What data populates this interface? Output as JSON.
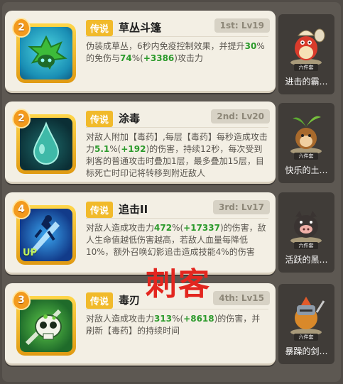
{
  "skills": [
    {
      "level": "2",
      "tag": "传说",
      "name": "草丛斗篷",
      "rank": "1st: Lv19",
      "desc_parts": [
        "伪装成草丛，6秒内免疫控制效果，并提升",
        "30",
        "%的免伤与",
        "74",
        "%(",
        "+3386",
        ")攻击力"
      ],
      "pet_name": "进击的霸…",
      "pet_badge": "六件套",
      "icon": "grass-cloak-icon"
    },
    {
      "level": "2",
      "tag": "传说",
      "name": "涂毒",
      "rank": "2nd: Lv20",
      "desc_parts": [
        "对敌人附加【毒药】,每层【毒药】每秒造成攻击力",
        "5.1",
        "%(",
        "+192",
        ")的伤害，持续12秒，每次受到刺客的普通攻击时叠加1层，最多叠加15层，目标死亡时印记将转移到附近敌人"
      ],
      "pet_name": "快乐的土…",
      "pet_badge": "六件套",
      "icon": "poison-drop-icon"
    },
    {
      "level": "4",
      "tag": "传说",
      "name": "追击II",
      "rank": "3rd: Lv17",
      "desc_parts": [
        "对敌人造成攻击力",
        "472",
        "%(",
        "+17337",
        ")的伤害，敌人生命值越低伤害越高，若敌人血量每降低10%，额外召唤幻影追击造成技能4%的伤害"
      ],
      "pet_name": "活跃的黑…",
      "pet_badge": "六件套",
      "icon": "pursuit-icon",
      "up": "UP"
    },
    {
      "level": "3",
      "tag": "传说",
      "name": "毒刃",
      "rank": "4th: Lv15",
      "desc_parts": [
        "对敌人造成攻击力",
        "313",
        "%(",
        "+8618",
        ")的伤害，并刷新【毒药】的持续时间"
      ],
      "pet_name": "暴躁的剑…",
      "pet_badge": "六件套",
      "icon": "poison-skull-icon"
    }
  ],
  "watermark": "刺客",
  "colors": {
    "card_bg": "#f3efe4",
    "tag": "#f1ba2b",
    "green": "#2b9a2b",
    "panel": "#5d5852",
    "watermark": "#e3261f"
  }
}
